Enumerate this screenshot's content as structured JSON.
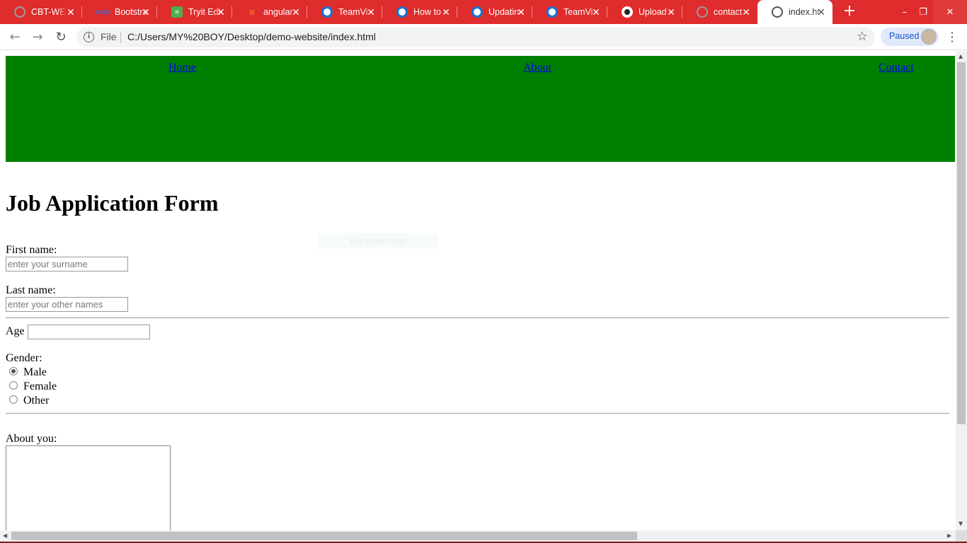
{
  "browser": {
    "tabs": [
      {
        "title": "CBT-WE",
        "icon": "globe-icon",
        "active": false
      },
      {
        "title": "Bootstra",
        "icon": "mdb-icon",
        "active": false
      },
      {
        "title": "Tryit Edi",
        "icon": "tryit-icon",
        "active": false
      },
      {
        "title": "angular",
        "icon": "stackoverflow-icon",
        "active": false
      },
      {
        "title": "TeamVi",
        "icon": "teamviewer-icon",
        "active": false
      },
      {
        "title": "How to",
        "icon": "teamviewer-icon",
        "active": false
      },
      {
        "title": "Updatin",
        "icon": "teamviewer-icon",
        "active": false
      },
      {
        "title": "TeamVi",
        "icon": "teamviewer-icon",
        "active": false
      },
      {
        "title": "Upload",
        "icon": "github-icon",
        "active": false
      },
      {
        "title": "contact",
        "icon": "globe-icon",
        "active": false
      },
      {
        "title": "index.ht",
        "icon": "globe-icon",
        "active": true
      }
    ],
    "new_tab_label": "+",
    "window_controls": {
      "minimize": "–",
      "restore": "❐",
      "close": "✕"
    },
    "toolbar": {
      "back": "←",
      "forward": "→",
      "reload": "↻",
      "scheme": "File",
      "url": "C:/Users/MY%20BOY/Desktop/demo-website/index.html",
      "bookmark_star": "☆",
      "profile_status": "Paused",
      "menu": "⋮"
    },
    "colors": {
      "tabstrip": "#df2c2c",
      "paused_bg": "#dfe9fb",
      "paused_text": "#1a56c8"
    }
  },
  "page": {
    "nav": {
      "background": "#008000",
      "links": [
        "Home",
        "About",
        "Contact"
      ]
    },
    "heading": "Job Application Form",
    "overlay_text": "Full-screen Snip",
    "form": {
      "first_name_label": "First name:",
      "first_name_placeholder": "enter your surname",
      "last_name_label": "Last name:",
      "last_name_placeholder": "enter your other names",
      "age_label": "Age",
      "gender_label": "Gender:",
      "gender_options": [
        "Male",
        "Female",
        "Other"
      ],
      "gender_selected": "Male",
      "about_label": "About you:"
    }
  }
}
